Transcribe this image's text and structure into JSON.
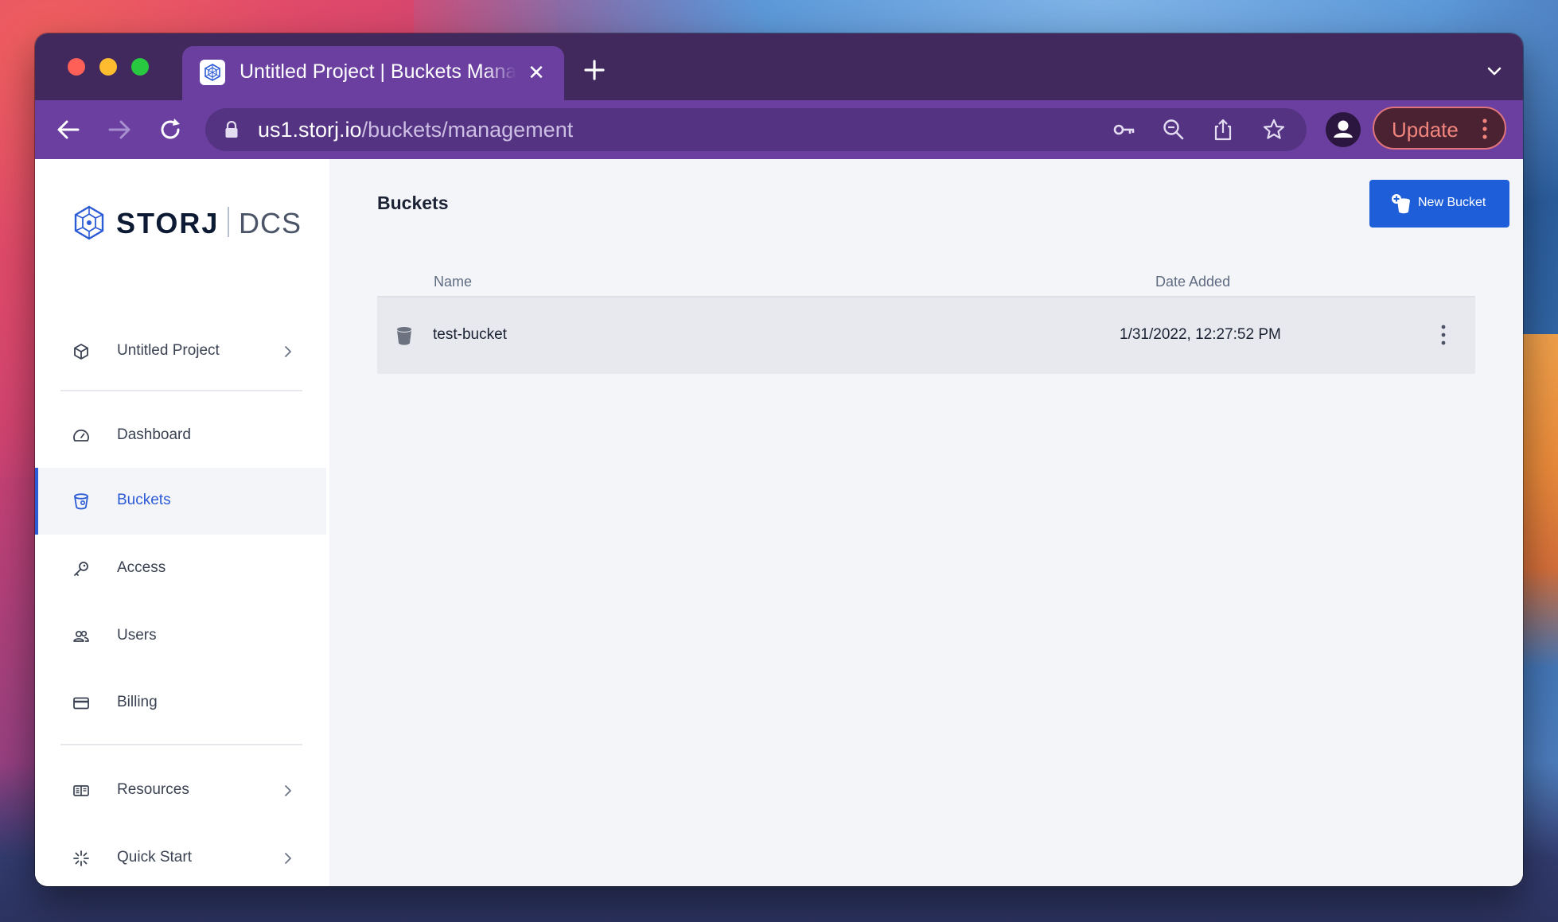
{
  "browser": {
    "tab_title": "Untitled Project | Buckets Management",
    "url_host": "us1.storj.io",
    "url_path": "/buckets/management",
    "update_label": "Update",
    "accent_color": "#6a3fa0"
  },
  "brand": {
    "name": "STORJ",
    "suffix": "DCS"
  },
  "sidebar": {
    "project": {
      "label": "Untitled Project",
      "icon": "cube-icon"
    },
    "items": [
      {
        "label": "Dashboard",
        "icon": "gauge-icon"
      },
      {
        "label": "Buckets",
        "icon": "bucket-icon",
        "active": true
      },
      {
        "label": "Access",
        "icon": "key-icon"
      },
      {
        "label": "Users",
        "icon": "users-icon"
      },
      {
        "label": "Billing",
        "icon": "credit-card-icon"
      }
    ],
    "resources": {
      "label": "Resources",
      "icon": "book-icon"
    },
    "quick_start": {
      "label": "Quick Start",
      "icon": "sparkle-icon"
    }
  },
  "main": {
    "title": "Buckets",
    "new_bucket_label": "New Bucket",
    "columns": {
      "name": "Name",
      "date": "Date Added"
    },
    "rows": [
      {
        "name": "test-bucket",
        "date": "1/31/2022, 12:27:52 PM"
      }
    ]
  }
}
